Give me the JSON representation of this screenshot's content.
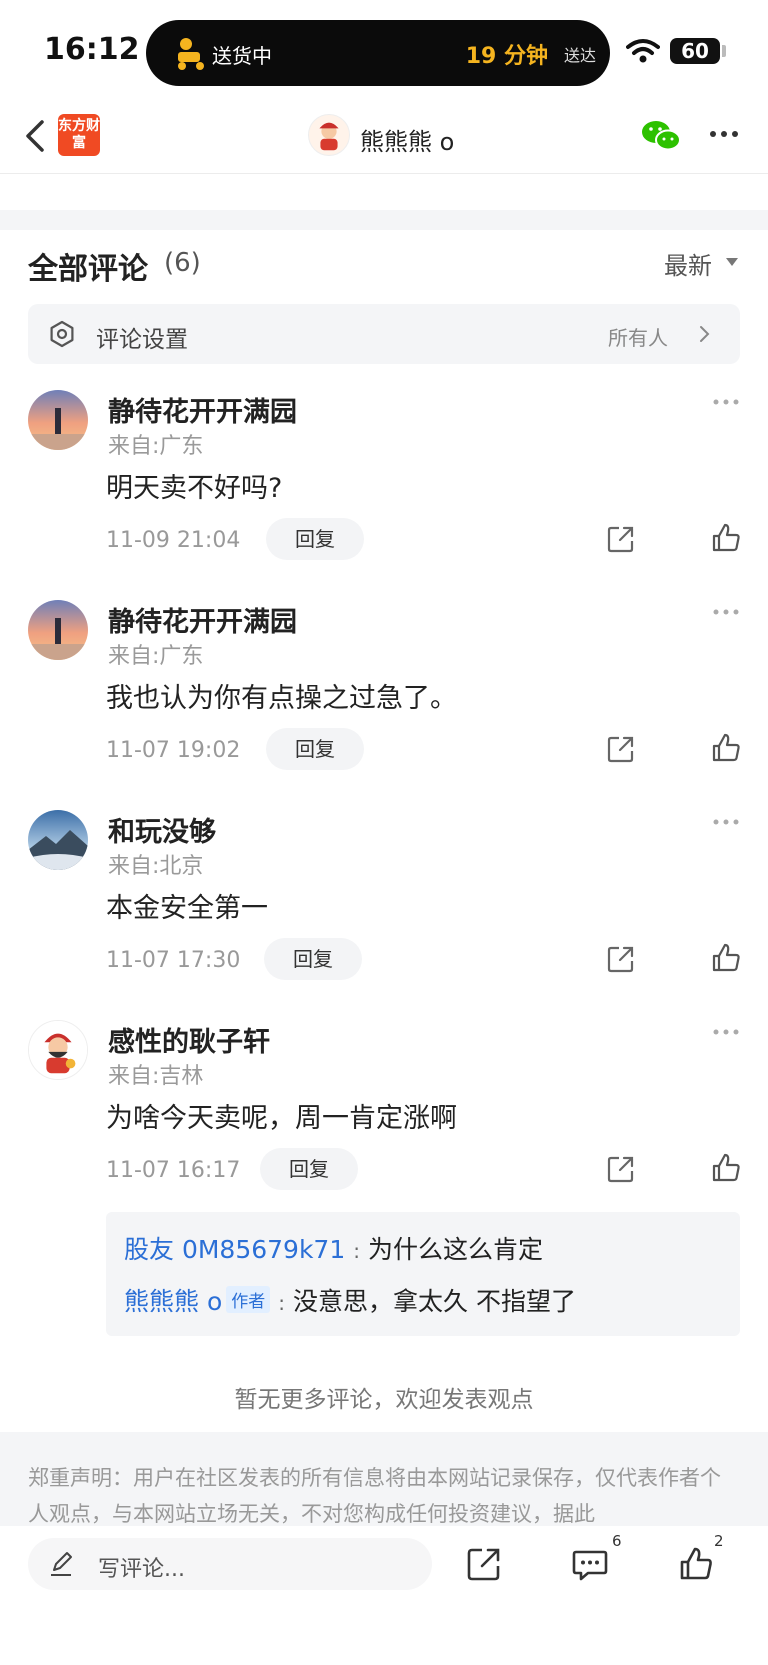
{
  "status_bar": {
    "time": "16:12",
    "island_label": "送货中",
    "island_eta": "19 分钟",
    "island_eta_suffix": "送达",
    "battery": "60"
  },
  "nav": {
    "brand_logo": "东方财富",
    "title": "熊熊熊 o"
  },
  "comments_header": {
    "title": "全部评论",
    "count": "(6)",
    "sort": "最新"
  },
  "settings": {
    "label": "评论设置",
    "value": "所有人"
  },
  "comments": [
    {
      "name": "静待花开开满园",
      "location": "来自:广东",
      "text": "明天卖不好吗?",
      "time": "11-09 21:04",
      "reply_label": "回复"
    },
    {
      "name": "静待花开开满园",
      "location": "来自:广东",
      "text": "我也认为你有点操之过急了。",
      "time": "11-07 19:02",
      "reply_label": "回复"
    },
    {
      "name": "和玩没够",
      "location": "来自:北京",
      "text": "本金安全第一",
      "time": "11-07 17:30",
      "reply_label": "回复"
    },
    {
      "name": "感性的耿子轩",
      "location": "来自:吉林",
      "text": "为啥今天卖呢，周一肯定涨啊",
      "time": "11-07 16:17",
      "reply_label": "回复"
    }
  ],
  "replies": [
    {
      "user": "股友 0M85679k71",
      "author_tag": "",
      "text": "为什么这么肯定"
    },
    {
      "user": "熊熊熊 o",
      "author_tag": "作者",
      "text": "没意思，拿太久   不指望了"
    }
  ],
  "no_more": "暂无更多评论，欢迎发表观点",
  "disclaimer": "郑重声明：用户在社区发表的所有信息将由本网站记录保存，仅代表作者个人观点，与本网站立场无关，不对您构成任何投资建议，据此",
  "bottom_bar": {
    "input_placeholder": "写评论...",
    "comment_count": "6",
    "like_count": "2"
  },
  "colors": {
    "accent_blue": "#2b6fd6",
    "brand_orange": "#f04a23",
    "wechat_green": "#2dc100",
    "eta_yellow": "#f5b41f"
  }
}
